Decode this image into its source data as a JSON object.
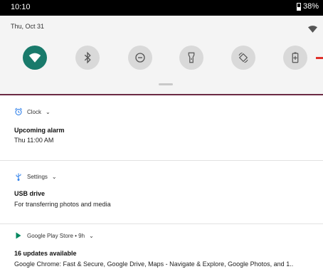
{
  "status_bar": {
    "time": "10:10",
    "battery": "38%"
  },
  "quick_settings": {
    "date": "Thu, Oct 31",
    "tiles": [
      {
        "name": "wifi",
        "icon": "wifi-icon",
        "active": true
      },
      {
        "name": "bluetooth",
        "icon": "bluetooth-icon",
        "active": false
      },
      {
        "name": "do-not-disturb",
        "icon": "do-not-disturb-icon",
        "active": false
      },
      {
        "name": "flashlight",
        "icon": "flashlight-icon",
        "active": false
      },
      {
        "name": "auto-rotate",
        "icon": "auto-rotate-icon",
        "active": false
      },
      {
        "name": "battery-saver",
        "icon": "battery-saver-icon",
        "active": false
      }
    ],
    "colors": {
      "active_tile": "#197a6b",
      "inactive_tile": "#d9d9d9",
      "accent_line": "#6b2a44",
      "red_indicator": "#e0302a"
    }
  },
  "notifications": [
    {
      "app": "Clock",
      "icon": "alarm-clock-icon",
      "title": "Upcoming alarm",
      "text": "Thu 11:00 AM"
    },
    {
      "app": "Settings",
      "icon": "usb-icon",
      "title": "USB drive",
      "text": "For transferring photos and media"
    },
    {
      "app": "Google Play Store • 9h",
      "icon": "play-store-icon",
      "title": "16 updates available",
      "text": "Google Chrome: Fast & Secure, Google Drive, Maps - Navigate & Explore, Google Photos, and 1.."
    }
  ]
}
